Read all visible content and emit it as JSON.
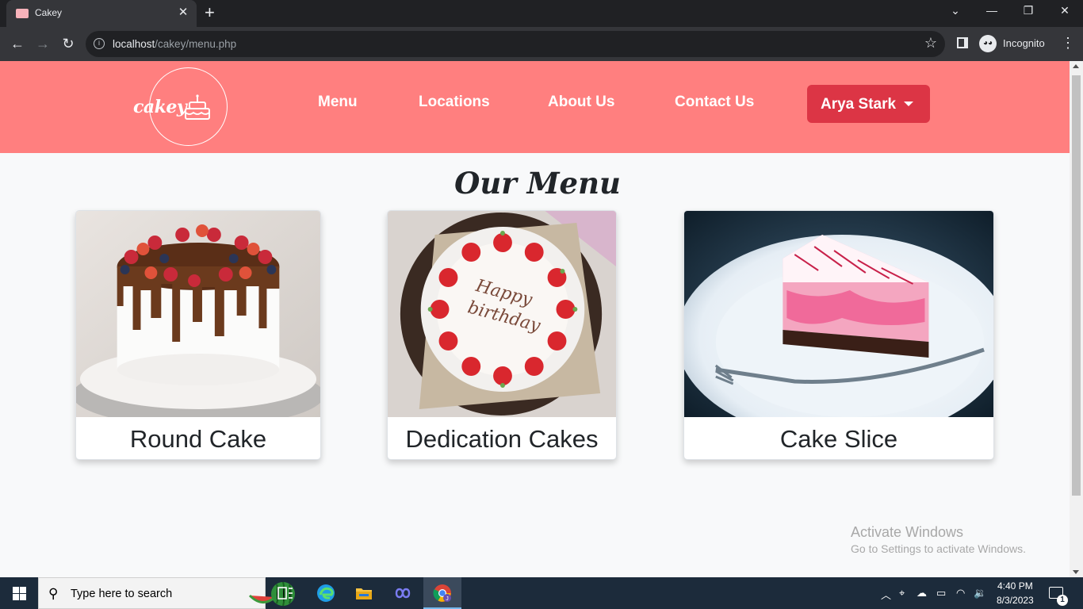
{
  "browser": {
    "tab_title": "Cakey",
    "url_host": "localhost",
    "url_path": "/cakey/menu.php",
    "profile_label": "Incognito"
  },
  "site": {
    "logo_text": "cakey",
    "nav": [
      {
        "label": "Menu"
      },
      {
        "label": "Locations"
      },
      {
        "label": "About Us"
      },
      {
        "label": "Contact Us"
      }
    ],
    "user_button": "Arya Stark",
    "page_title": "Our Menu",
    "cards": [
      {
        "label": "Round Cake"
      },
      {
        "label": "Dedication Cakes"
      },
      {
        "label": "Cake Slice"
      }
    ],
    "colors": {
      "header_bg": "#ff7f7f",
      "user_button_bg": "#dc3545",
      "page_bg": "#f8f9fa"
    }
  },
  "watermark": {
    "line1": "Activate Windows",
    "line2": "Go to Settings to activate Windows."
  },
  "taskbar": {
    "search_placeholder": "Type here to search",
    "time": "4:40 PM",
    "date": "8/3/2023",
    "notification_count": "1"
  }
}
